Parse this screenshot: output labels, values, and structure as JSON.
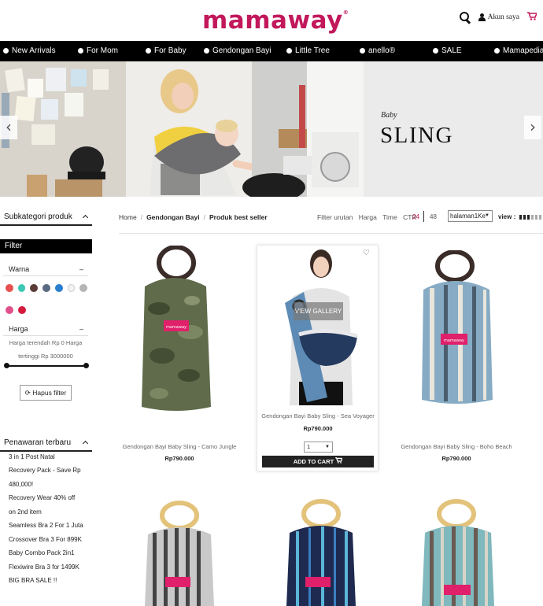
{
  "header": {
    "logo": "mamaway",
    "logo_mark": "®",
    "account_label": "Akun saya"
  },
  "nav": {
    "items": [
      {
        "label": "New Arrivals"
      },
      {
        "label": "For Mom"
      },
      {
        "label": "For Baby"
      },
      {
        "label": "Gendongan Bayi"
      },
      {
        "label": "Little Tree"
      },
      {
        "label": "anello®"
      },
      {
        "label": "SALE"
      },
      {
        "label": "Mamapedia"
      }
    ]
  },
  "hero": {
    "small_title": "Baby",
    "big_title": "SLING",
    "prev_glyph": "‹",
    "next_glyph": "›"
  },
  "sidebar": {
    "subcategory_title": "Subkategori produk",
    "filter_title": "Filter",
    "color_label": "Warna",
    "collapse_glyph": "–",
    "colors": [
      "#e8504d",
      "#3cc8b4",
      "#5a3b36",
      "#5a6a80",
      "#2a7fd0",
      "#f2f2f2",
      "#b5b5b5",
      "#e0508a",
      "#d61a3c"
    ],
    "price_label": "Harga",
    "price_range_line1": "Harga terendah Rp 0  Harga",
    "price_range_line2": "tertinggi Rp 3000000",
    "price_slider": {
      "min": 0,
      "max": 3000000
    },
    "reset_label": "Hapus filter",
    "offers_title": "Penawaran terbaru",
    "offers": [
      "3 in 1 Post Natal",
      "Recovery Pack - Save Rp",
      "480,000!",
      "Recovery Wear 40% off",
      "on 2nd item",
      "Seamless Bra 2 For 1 Juta",
      "Crossover Bra 3 For 899K",
      "Baby Combo Pack 2in1",
      "Flexiwire Bra 3 for 1499K",
      "BIG BRA SALE !!"
    ]
  },
  "toolbar": {
    "breadcrumb": {
      "home": "Home",
      "sep": "/",
      "category": "Gendongan Bayi",
      "current": "Produk best seller"
    },
    "sort_label": "Filter urutan",
    "sort_options": [
      "Harga",
      "Time",
      "CTR"
    ],
    "per_page": [
      "24",
      "48"
    ],
    "page_select": "halaman1Ke",
    "view_label": "view :"
  },
  "products": [
    {
      "name": "Gendongan Bayi Baby Sling - Camo Jungle",
      "price": "Rp790.000"
    },
    {
      "name": "Gendongan Bayi Baby Sling - Sea Voyager",
      "price": "Rp790.000",
      "gallery_label": "VIEW GALLERY",
      "qty": "1",
      "add_to_cart": "ADD TO CART"
    },
    {
      "name": "Gendongan Bayi Baby Sling - Boho Beach",
      "price": "Rp790.000"
    }
  ],
  "sling_tag": "mamaway Baby Sling",
  "colors": {
    "brand": "#c2185b",
    "nav_bg": "#000000"
  }
}
